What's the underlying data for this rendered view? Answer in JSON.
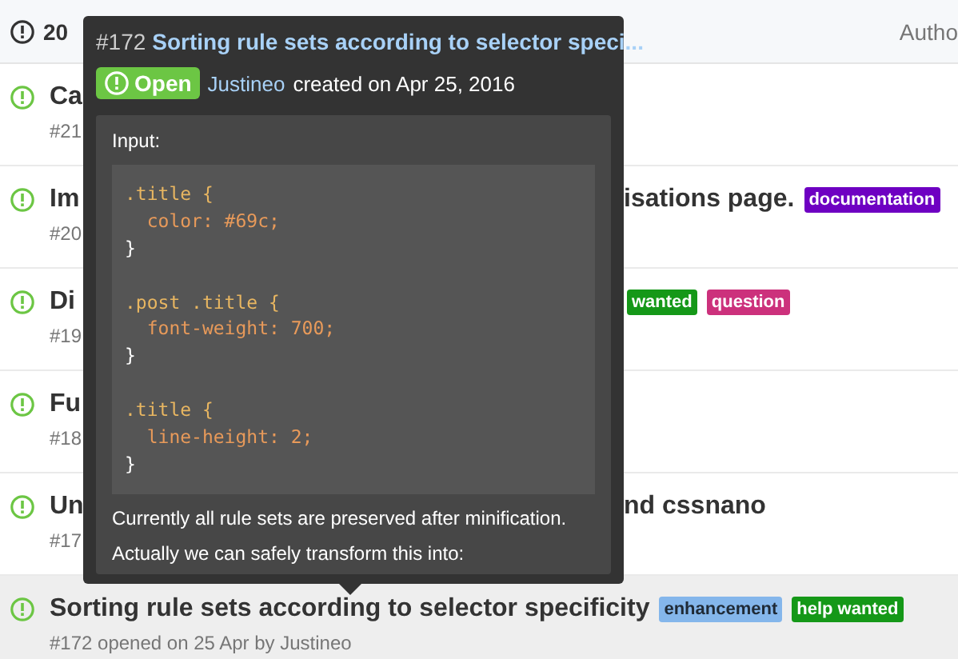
{
  "header": {
    "open_count": "20",
    "author_filter": "Autho"
  },
  "issues": [
    {
      "title": "Ca",
      "meta": "#21",
      "selected": false
    },
    {
      "title": "Im",
      "title_right": "isations page.",
      "meta": "#20",
      "labels": [
        {
          "text": "documentation",
          "color": "#6e00c2"
        }
      ],
      "selected": false
    },
    {
      "title": "Di",
      "meta": "#19",
      "labels": [
        {
          "text": "wanted",
          "color": "#159818"
        },
        {
          "text": "question",
          "color": "#cc317c"
        }
      ],
      "selected": false
    },
    {
      "title": "Fu",
      "meta": "#18",
      "selected": false
    },
    {
      "title": "Un",
      "title_right": "nd cssnano",
      "meta": "#17",
      "selected": false
    },
    {
      "title": "Sorting rule sets according to selector specificity",
      "meta": "#172 opened on 25 Apr by Justineo",
      "labels": [
        {
          "text": "enhancement",
          "color": "#84b6eb"
        },
        {
          "text": "help wanted",
          "color": "#159818"
        }
      ],
      "selected": true
    }
  ],
  "popover": {
    "number": "#172",
    "title": "Sorting rule sets according to selector speci...",
    "state": "Open",
    "author": "Justineo",
    "created": "created on Apr 25, 2016",
    "intro": "Input:",
    "code": [
      {
        "kind": "selector",
        "text": ".title {"
      },
      {
        "kind": "declaration",
        "text": "  color: #69c;"
      },
      {
        "kind": "brace",
        "text": "}"
      },
      {
        "kind": "blank"
      },
      {
        "kind": "selector",
        "text": ".post .title {"
      },
      {
        "kind": "declaration",
        "text": "  font-weight: 700;"
      },
      {
        "kind": "brace",
        "text": "}"
      },
      {
        "kind": "blank"
      },
      {
        "kind": "selector",
        "text": ".title {"
      },
      {
        "kind": "declaration",
        "text": "  line-height: 2;"
      },
      {
        "kind": "brace",
        "text": "}"
      }
    ],
    "paragraphs": [
      "Currently all rule sets are preserved after minification.",
      "Actually we can safely transform this into:"
    ]
  }
}
